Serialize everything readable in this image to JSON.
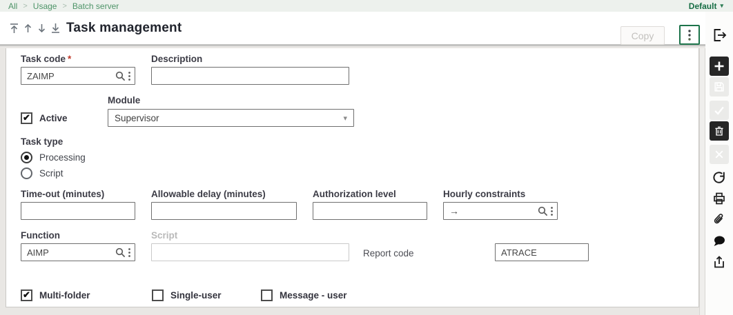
{
  "topbar": {
    "breadcrumb": [
      "All",
      "Usage",
      "Batch server"
    ],
    "separator": ">",
    "profile": "Default",
    "profile_caret": "▾"
  },
  "header": {
    "title": "Task management",
    "copy_label": "Copy",
    "nav_icons": [
      "first-record",
      "previous-record",
      "next-record",
      "last-record"
    ],
    "more_actions_icon": "vertical-dots",
    "logout_icon": "logout"
  },
  "sidebar": {
    "icons": [
      {
        "name": "new-plus",
        "enabled": true
      },
      {
        "name": "save",
        "enabled": false
      },
      {
        "name": "confirm-check",
        "enabled": false
      },
      {
        "name": "delete-trash",
        "enabled": true
      },
      {
        "name": "cancel-x",
        "enabled": false
      },
      {
        "name": "refresh",
        "enabled": true
      },
      {
        "name": "print",
        "enabled": true
      },
      {
        "name": "attachment-paperclip",
        "enabled": true
      },
      {
        "name": "comment-bubble",
        "enabled": true
      },
      {
        "name": "share-export",
        "enabled": true
      }
    ]
  },
  "form": {
    "task_code": {
      "label": "Task code",
      "required": "*",
      "value": "ZAIMP",
      "icons": [
        "search-icon",
        "options-dots-icon"
      ]
    },
    "description": {
      "label": "Description",
      "value": ""
    },
    "active": {
      "label": "Active",
      "checked": true
    },
    "module": {
      "label": "Module",
      "value": "Supervisor",
      "caret": "▾"
    },
    "task_type": {
      "label": "Task type",
      "options": [
        {
          "label": "Processing",
          "selected": true
        },
        {
          "label": "Script",
          "selected": false
        }
      ]
    },
    "timeout": {
      "label": "Time-out (minutes)",
      "value": ""
    },
    "allowable_delay": {
      "label": "Allowable delay (minutes)",
      "value": ""
    },
    "authorization_level": {
      "label": "Authorization level",
      "value": ""
    },
    "hourly_constraints": {
      "label": "Hourly constraints",
      "value": "",
      "prefix": "→",
      "icons": [
        "search-icon",
        "options-dots-icon"
      ]
    },
    "function": {
      "label": "Function",
      "value": "AIMP",
      "icons": [
        "search-icon",
        "options-dots-icon"
      ]
    },
    "script": {
      "label": "Script",
      "value": "",
      "disabled": true
    },
    "report_code": {
      "label": "Report code",
      "value": "ATRACE"
    },
    "multi_folder": {
      "label": "Multi-folder",
      "checked": true
    },
    "single_user": {
      "label": "Single-user",
      "checked": false
    },
    "message_user": {
      "label": "Message - user",
      "checked": false
    }
  },
  "colors": {
    "accent_green": "#1c734a",
    "breadcrumb_green": "#4e9468",
    "topbar_bg": "#edf1ed",
    "page_bg": "#e9e7e4",
    "required_red": "#c0392b",
    "label_dark": "#3b3b45",
    "icon_black": "#262626",
    "disabled_gray": "#ebebe9"
  }
}
